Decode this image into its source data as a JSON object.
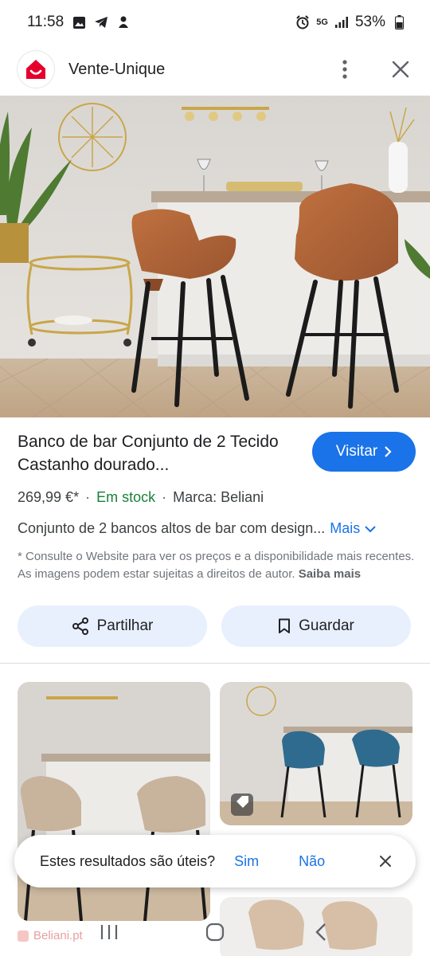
{
  "status_bar": {
    "time": "11:58",
    "network": "5G",
    "battery": "53%"
  },
  "header": {
    "site_name": "Vente-Unique",
    "brand_color": "#e4002b"
  },
  "product": {
    "title": "Banco de bar Conjunto de 2 Tecido Castanho dourado...",
    "visit_label": "Visitar",
    "price": "269,99 €*",
    "stock": "Em stock",
    "brand": "Marca: Beliani",
    "description": "Conjunto de 2 bancos altos de bar com design...",
    "more_label": "Mais",
    "disclaimer": "* Consulte o Website para ver os preços e a disponibilidade mais recentes. As imagens podem estar sujeitas a direitos de autor.",
    "learn_more": "Saiba mais"
  },
  "actions": {
    "share_label": "Partilhar",
    "save_label": "Guardar"
  },
  "related": {
    "source": "Beliani.pt"
  },
  "feedback": {
    "question": "Estes resultados são úteis?",
    "yes": "Sim",
    "no": "Não"
  },
  "colors": {
    "accent": "#1a73e8",
    "stock_green": "#188038",
    "button_bg": "#e8f0fe"
  }
}
